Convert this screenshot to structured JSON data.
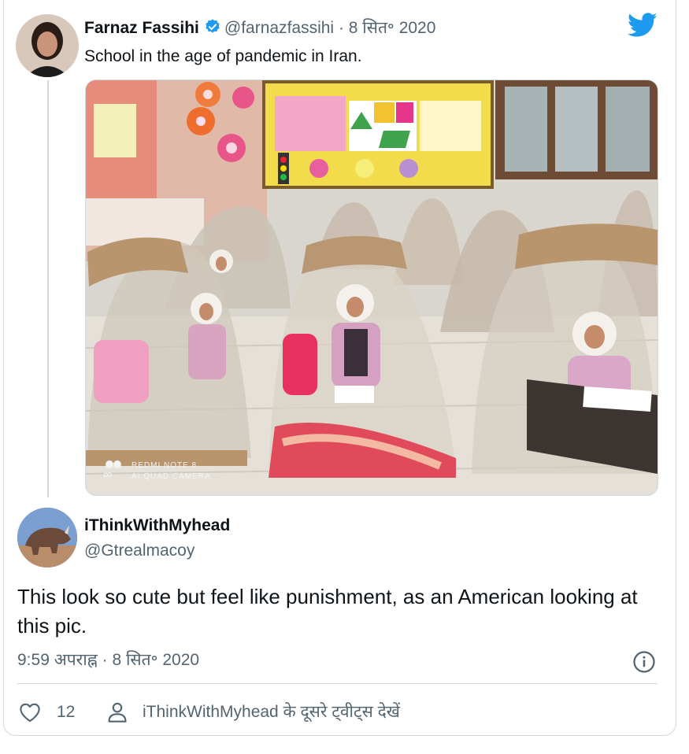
{
  "quoted_tweet": {
    "name": "Farnaz Fassihi",
    "handle": "@farnazfassihi",
    "separator": "·",
    "date": "8 सित॰ 2020",
    "text": "School in the age of pandemic in Iran.",
    "media_watermark_line1": "REDMI NOTE 8",
    "media_watermark_line2": "AI QUAD CAMERA"
  },
  "tweet": {
    "name": "iThinkWithMyhead",
    "handle": "@Gtrealmacoy",
    "text": "This look so cute but feel like punishment, as an American looking at this pic.",
    "time": "9:59 अपराह्न",
    "separator": "·",
    "date": "8 सित॰ 2020"
  },
  "actions": {
    "like_count": "12",
    "more_tweets_link": "iThinkWithMyhead के दूसरे ट्वीट्स देखें"
  },
  "icons": {
    "brand": "twitter-bird-icon",
    "verified": "verified-badge-icon",
    "info": "info-icon",
    "like": "heart-icon",
    "profile": "person-icon"
  },
  "colors": {
    "brand": "#1d9bf0",
    "text": "#0f1419",
    "muted": "#536471",
    "border": "#cfd9de"
  }
}
